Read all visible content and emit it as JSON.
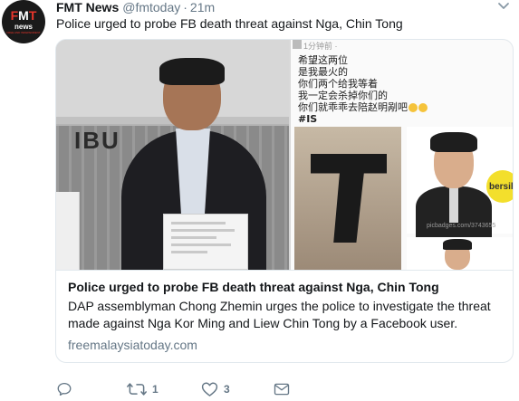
{
  "tweet": {
    "author_name": "FMT News",
    "author_handle": "@fmtoday",
    "separator": "·",
    "time": "21m",
    "text": "Police urged to probe FB death threat against Nga, Chin Tong"
  },
  "avatar": {
    "logo_f": "F",
    "logo_m": "M",
    "logo_t": "T",
    "logo_sub": "news",
    "logo_tag": "FREE AND INDEPENDENT"
  },
  "card": {
    "title": "Police urged to probe FB death threat against Nga, Chin Tong",
    "description": "DAP assemblyman Chong Zhemin urges the police to investigate the threat made against Nga Kor Ming and Liew Chin Tong by a Facebook user.",
    "domain": "freemalaysiatoday.com",
    "image_text": {
      "sign": "IBU",
      "fb_time": "1分钟前 · ",
      "chinese_lines": [
        "希望这两位",
        "是我最火的",
        "你们两个给我等着",
        "我一定会杀掉你们的",
        "你们就乖乖去陪赵明剐吧",
        "#IS"
      ],
      "bersih_logo": "bersih",
      "watermark": "picbadges.com/3743655"
    }
  },
  "actions": {
    "reply_count": "",
    "retweet_count": "1",
    "like_count": "3"
  },
  "colors": {
    "text": "#14171a",
    "secondary": "#657786",
    "border": "#e1e8ed",
    "brand_red": "#e8352b"
  }
}
